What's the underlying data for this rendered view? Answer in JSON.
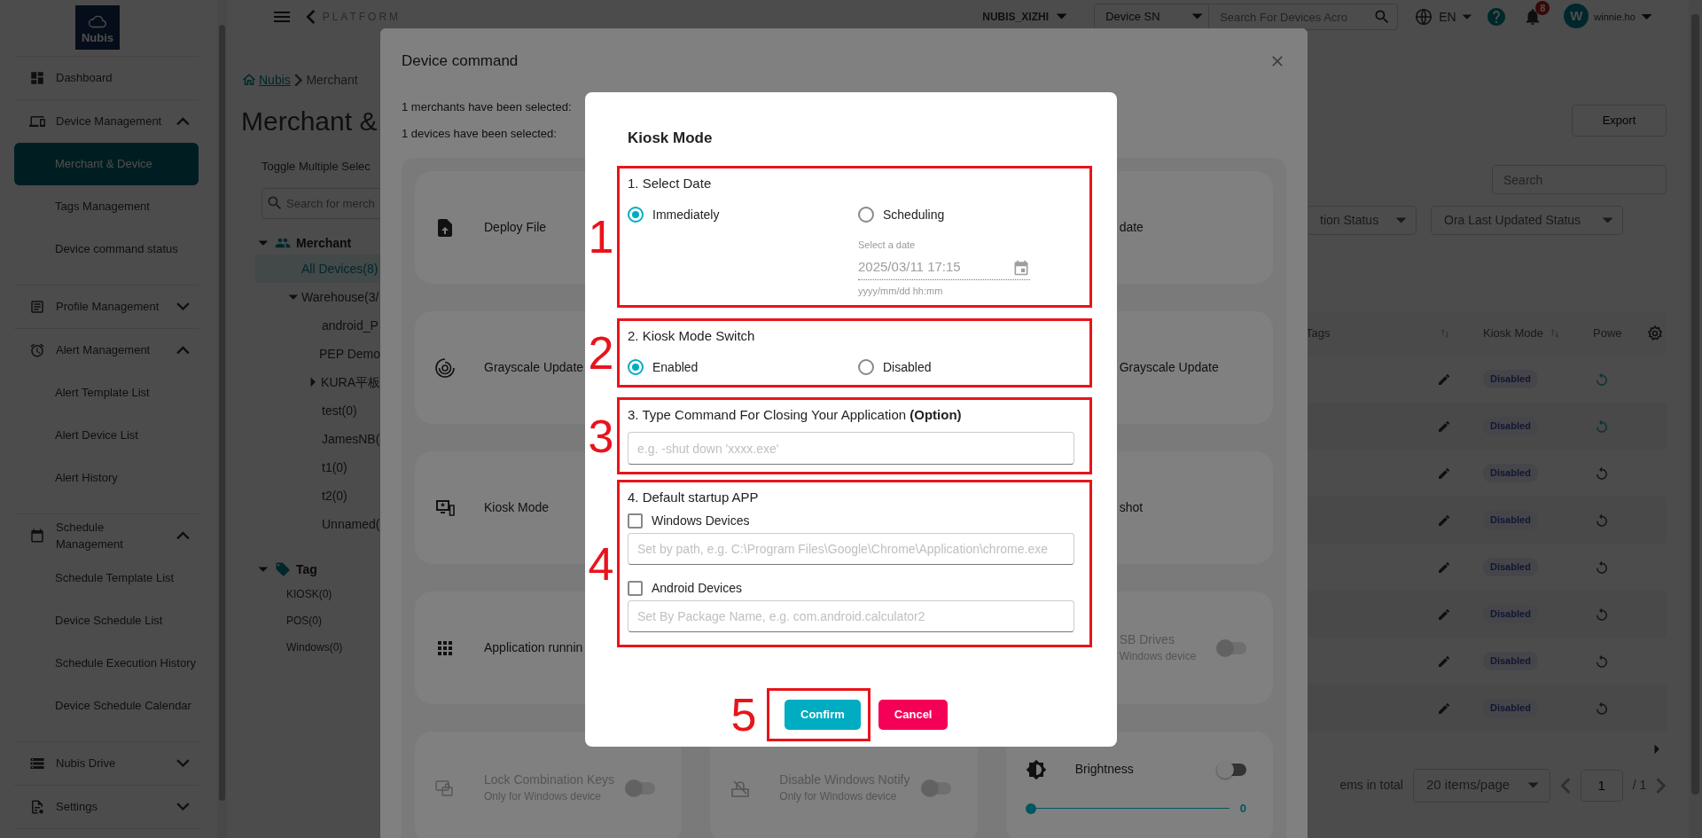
{
  "sidebar": {
    "logo": "Nubis",
    "items": [
      {
        "kind": "link",
        "label": "Dashboard",
        "selected": false
      },
      {
        "kind": "group",
        "label": "Device Management",
        "selected": false,
        "expanded": true,
        "children": [
          {
            "label": "Merchant & Device",
            "selected": true
          },
          {
            "label": "Tags Management",
            "selected": false
          },
          {
            "label": "Device command status",
            "selected": false
          }
        ]
      },
      {
        "kind": "group",
        "label": "Profile Management",
        "selected": false,
        "expanded": false
      },
      {
        "kind": "group",
        "label": "Alert Management",
        "selected": false,
        "expanded": true,
        "children": [
          {
            "label": "Alert Template List",
            "selected": false
          },
          {
            "label": "Alert Device List",
            "selected": false
          },
          {
            "label": "Alert History",
            "selected": false
          }
        ]
      },
      {
        "kind": "group",
        "label": "Schedule Management",
        "selected": false,
        "expanded": true,
        "children": [
          {
            "label": "Schedule Template List",
            "selected": false
          },
          {
            "label": "Device Schedule List",
            "selected": false
          },
          {
            "label": "Schedule Execution History",
            "selected": false
          },
          {
            "label": "Device Schedule Calendar",
            "selected": false
          }
        ]
      },
      {
        "kind": "group",
        "label": "Nubis Drive",
        "selected": false,
        "expanded": false
      },
      {
        "kind": "group",
        "label": "Settings",
        "selected": false,
        "expanded": false
      }
    ]
  },
  "topbar": {
    "section": "PLATFORM",
    "organization": "NUBIS_XIZHI",
    "search_type": "Device SN",
    "search_placeholder": "Search For Devices Acro",
    "language": "EN",
    "notifications": "8",
    "avatar": "W",
    "user": "winnie.ho"
  },
  "breadcrumb": [
    "Nubis",
    "Merchant"
  ],
  "page_title": "Merchant &",
  "export_button": "Export",
  "tree": {
    "toggle_label": "Toggle Multiple Selec",
    "search_placeholder": "Search for merch",
    "sections": [
      {
        "kind": "merchant",
        "label": "Merchant",
        "expanded": true,
        "children": [
          {
            "label": "All Devices(8)",
            "selected": true
          },
          {
            "label": "Warehouse(3/",
            "selected": false,
            "expanded": true,
            "children": [
              {
                "label": "android_P",
                "selected": false
              },
              {
                "label": "PEP Demo",
                "selected": false
              },
              {
                "label": "KURA平板",
                "selected": false,
                "expanded": false
              },
              {
                "label": "test(0)",
                "selected": false
              },
              {
                "label": "JamesNB(",
                "selected": false
              },
              {
                "label": "t1(0)",
                "selected": false
              },
              {
                "label": "t2(0)",
                "selected": false
              },
              {
                "label": "Unnamed(",
                "selected": false
              }
            ]
          }
        ]
      },
      {
        "kind": "tag",
        "label": "Tag",
        "expanded": true,
        "children": [
          {
            "label": "KIOSK(0)",
            "selected": false
          },
          {
            "label": "POS(0)",
            "selected": false
          },
          {
            "label": "Windows(0)",
            "selected": false
          }
        ]
      }
    ]
  },
  "table_search_placeholder": "Search",
  "filters": [
    "tion Status",
    "Ora Last Updated Status"
  ],
  "table": {
    "columns": [
      "Tags",
      "Kiosk Mode",
      "Powe"
    ],
    "rows": [
      {
        "kiosk_mode": "Disabled",
        "power_active": true
      },
      {
        "kiosk_mode": "Disabled",
        "power_active": true
      },
      {
        "kiosk_mode": "Disabled",
        "power_active": false
      },
      {
        "kiosk_mode": "Disabled",
        "power_active": false
      },
      {
        "kiosk_mode": "Disabled",
        "power_active": false
      },
      {
        "kiosk_mode": "Disabled",
        "power_active": false
      },
      {
        "kiosk_mode": "Disabled",
        "power_active": false
      },
      {
        "kiosk_mode": "Disabled",
        "power_active": false
      }
    ]
  },
  "pagination": {
    "total": "ems in total",
    "page_size": "20 items/page",
    "page": "1",
    "pages": "/ 1"
  },
  "device_command": {
    "title": "Device command",
    "merchants_selected": "1 merchants have been selected:",
    "devices_selected": "1 devices have been selected:",
    "rows": [
      {
        "column_1": {
          "title": "Deploy File",
          "disabled": false
        },
        "column_3": {
          "title": "date",
          "disabled": false
        }
      },
      {
        "column_1": {
          "title": "Grayscale Update",
          "disabled": false
        },
        "column_3": {
          "title": "Grayscale Update",
          "disabled": false
        }
      },
      {
        "column_1": {
          "title": "Kiosk Mode",
          "disabled": false
        },
        "column_3": {
          "title": "shot",
          "disabled": false
        }
      },
      {
        "column_1": {
          "title": "Application runnin",
          "disabled": false
        },
        "column_3": {
          "title": "SB Drives",
          "note": "Windows device",
          "disabled": true,
          "toggle": {
            "on": false
          }
        }
      },
      {
        "column_1": {
          "title": "Lock Combination Keys",
          "note": "Only for Windows device",
          "disabled": true,
          "toggle": {
            "on": false
          }
        },
        "column_2": {
          "title": "Disable Windows Notify",
          "note": "Only for Windows device",
          "disabled": true,
          "toggle": {
            "on": false
          }
        },
        "column_3": {
          "title": "Brightness",
          "disabled": false,
          "toggle": {
            "on": false
          },
          "slider": {
            "level": 0,
            "reading": "0"
          }
        }
      }
    ]
  },
  "kiosk_dialog": {
    "title": "Kiosk Mode",
    "sections": [
      {
        "kind": "radio",
        "marker": "1",
        "title": "1. Select Date",
        "options": [
          {
            "label": "Immediately",
            "selected": true
          },
          {
            "label": "Scheduling",
            "selected": false
          }
        ],
        "date_field": {
          "label": "Select a date",
          "value": "2025/03/11 17:15",
          "hint": "yyyy/mm/dd hh:mm",
          "disabled": true
        }
      },
      {
        "kind": "radio",
        "marker": "2",
        "title": "2. Kiosk Mode Switch",
        "options": [
          {
            "label": "Enabled",
            "selected": true
          },
          {
            "label": "Disabled",
            "selected": false
          }
        ]
      },
      {
        "kind": "text",
        "marker": "3",
        "title": "3. Type Command For Closing Your Application **(Option)**",
        "placeholder": "e.g. -shut down 'xxxx.exe'"
      },
      {
        "kind": "checks",
        "marker": "4",
        "title": "4. Default startup APP",
        "items": [
          {
            "label": "Windows Devices",
            "checked": false,
            "placeholder": "Set by path, e.g. C:\\Program Files\\Google\\Chrome\\Application\\chrome.exe"
          },
          {
            "label": "Android Devices",
            "checked": false,
            "placeholder": "Set By Package Name, e.g. com.android.calculator2"
          }
        ]
      }
    ],
    "buttons": {
      "marker": "5",
      "items": [
        {
          "label": "Confirm",
          "kind": "confirm",
          "highlighted": true
        },
        {
          "label": "Cancel",
          "kind": "cancel",
          "highlighted": false
        }
      ]
    }
  }
}
